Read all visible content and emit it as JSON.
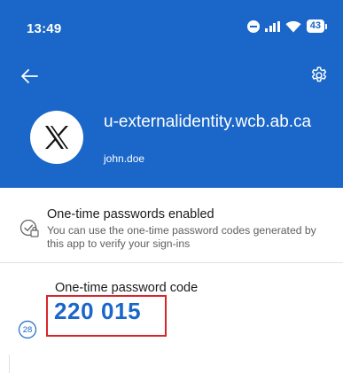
{
  "status_bar": {
    "time": "13:49",
    "battery_level": "43",
    "icons": [
      "do-not-disturb-icon",
      "signal-icon",
      "wifi-icon",
      "battery-icon"
    ]
  },
  "header": {
    "background_color": "#1a67c9",
    "back_icon": "arrow-left-icon",
    "settings_icon": "gear-icon"
  },
  "account": {
    "logo_icon": "x-logo",
    "name": "u-externalidentity.wcb.ab.ca",
    "username": "john.doe"
  },
  "otp_status": {
    "icon": "shield-check-icon",
    "title": "One-time passwords enabled",
    "description": "You can use the one-time password codes generated by this app to verify your sign-ins"
  },
  "otp_code": {
    "label": "One-time password code",
    "timer_seconds": "28",
    "code": "220 015",
    "highlight_color": "#d9242a"
  }
}
